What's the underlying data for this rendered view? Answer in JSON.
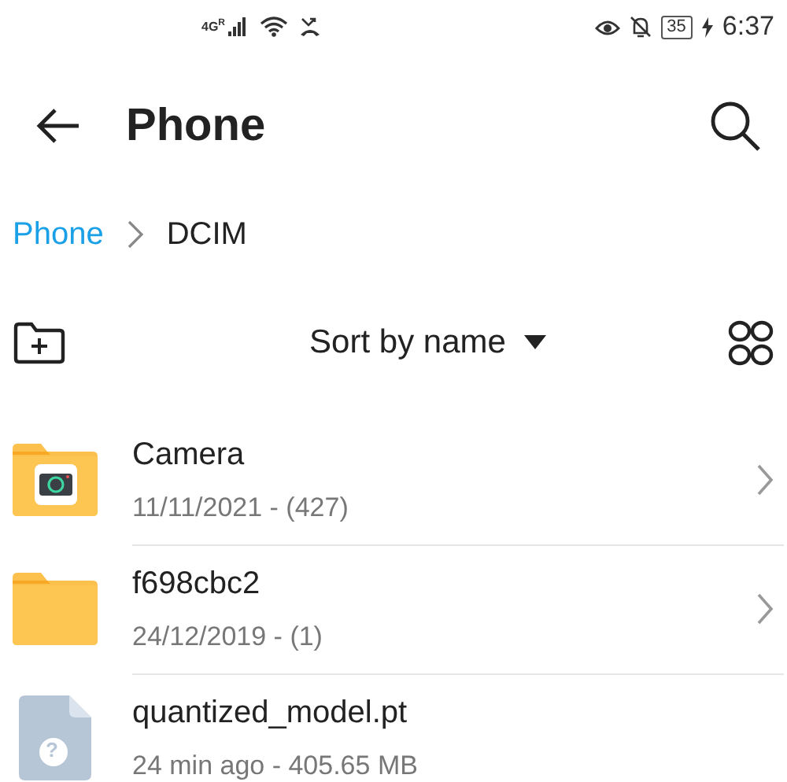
{
  "status_bar": {
    "network": "4G",
    "roaming": "R",
    "battery": "35",
    "time": "6:37"
  },
  "header": {
    "title": "Phone"
  },
  "breadcrumb": [
    {
      "label": "Phone",
      "selected": false
    },
    {
      "label": "DCIM",
      "selected": true
    }
  ],
  "toolbar": {
    "sort": "Sort by name"
  },
  "files": [
    {
      "kind": "camera-folder",
      "name": "Camera",
      "meta": "11/11/2021 - (427)"
    },
    {
      "kind": "folder",
      "name": "f698cbc2",
      "meta": "24/12/2019 - (1)"
    },
    {
      "kind": "file",
      "name": "quantized_model.pt",
      "meta": "24 min ago - 405.65 MB",
      "glyph": "?"
    }
  ]
}
